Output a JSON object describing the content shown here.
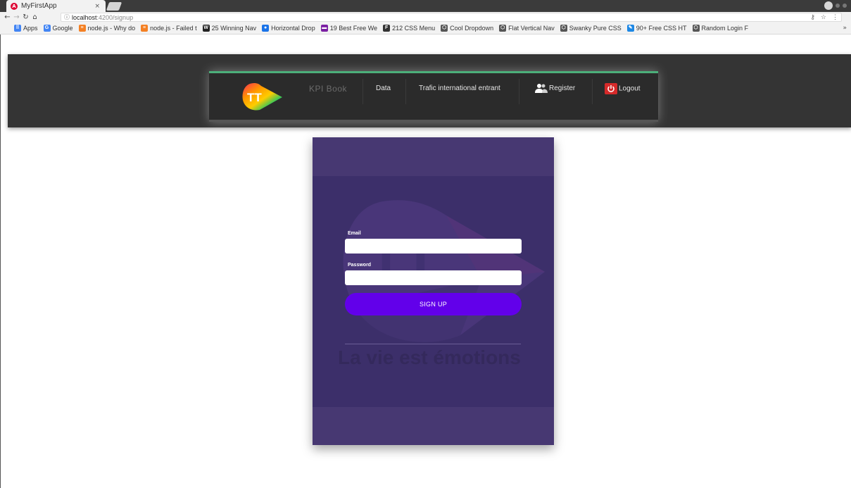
{
  "browser": {
    "tab_title": "MyFirstApp",
    "tab_close": "×",
    "url_host": "localhost",
    "url_path": ":4200/signup",
    "bookmarks": [
      {
        "label": "Apps",
        "icon": "apps-grid-icon",
        "color": "#4285f4"
      },
      {
        "label": "Google",
        "icon": "google-icon",
        "color": "#4285f4"
      },
      {
        "label": "node.js - Why do",
        "icon": "stackoverflow-icon",
        "color": "#f48024"
      },
      {
        "label": "node.js - Failed t",
        "icon": "stackoverflow-icon",
        "color": "#f48024"
      },
      {
        "label": "25 Winning Nav",
        "icon": "w-icon",
        "color": "#222222"
      },
      {
        "label": "Horizontal Drop",
        "icon": "circle-icon",
        "color": "#1a73e8"
      },
      {
        "label": "19 Best Free We",
        "icon": "bars-icon",
        "color": "#7b1fa2"
      },
      {
        "label": "212 CSS Menu",
        "icon": "f-icon",
        "color": "#333333"
      },
      {
        "label": "Cool Dropdown",
        "icon": "codepen-icon",
        "color": "#555555"
      },
      {
        "label": "Flat Vertical Nav",
        "icon": "codepen-icon",
        "color": "#555555"
      },
      {
        "label": "Swanky Pure CSS",
        "icon": "codepen-icon",
        "color": "#555555"
      },
      {
        "label": "90+ Free CSS HT",
        "icon": "pencil-icon",
        "color": "#1e88e5"
      },
      {
        "label": "Random Login F",
        "icon": "codepen-icon",
        "color": "#555555"
      }
    ],
    "bookmarks_more": "»"
  },
  "navbar": {
    "brand": "KPI Book",
    "items": [
      {
        "label": "Data"
      },
      {
        "label": "Trafic international entrant"
      },
      {
        "label": "Register"
      },
      {
        "label": "Logout"
      }
    ]
  },
  "form": {
    "email_label": "Email",
    "email_value": "",
    "password_label": "Password",
    "password_value": "",
    "submit_label": "SIGN UP"
  },
  "card": {
    "slogan": "La vie est émotions"
  },
  "colors": {
    "card_bg": "#473872",
    "button": "#6200ea",
    "navbar_accent": "#4caf7a",
    "logout_red": "#d62a2a"
  }
}
